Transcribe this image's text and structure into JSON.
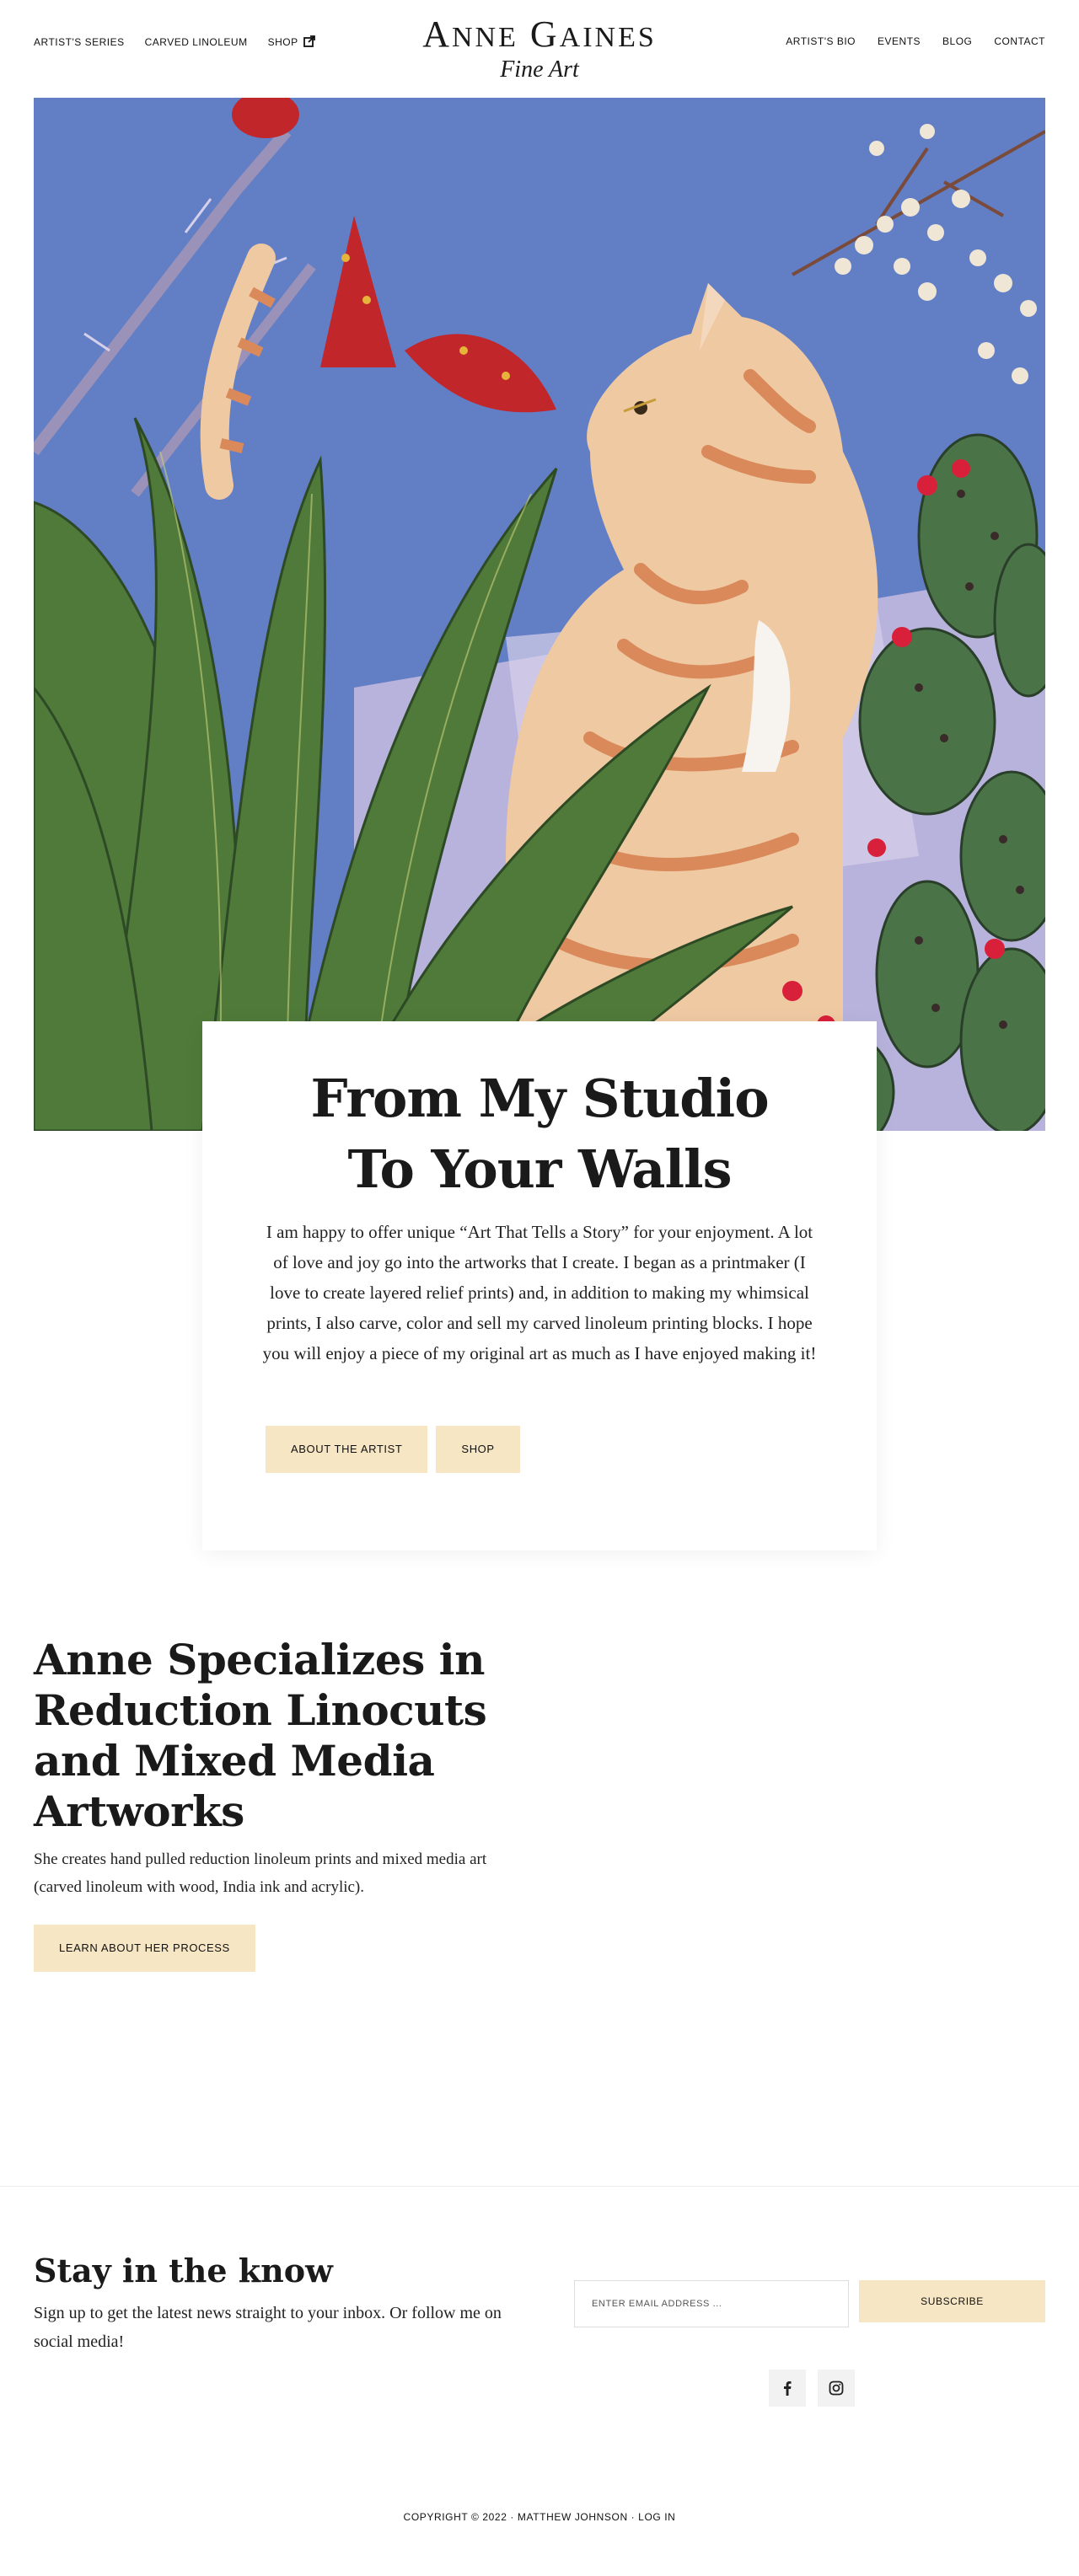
{
  "nav": {
    "left": [
      {
        "label": "Artist's Series"
      },
      {
        "label": "Carved Linoleum"
      },
      {
        "label": "Shop"
      }
    ],
    "right": [
      {
        "label": "Artist's Bio"
      },
      {
        "label": "Events"
      },
      {
        "label": "Blog"
      },
      {
        "label": "Contact"
      }
    ]
  },
  "logo": {
    "name_first_letter": "A",
    "name_first_rest": "NNE",
    "name_last_letter": "G",
    "name_last_rest": "AINES",
    "subtitle": "Fine Art"
  },
  "hero": {
    "colors": {
      "sky": "#5f7cc4",
      "cat": "#efc9a2",
      "stripes": "#d9895a",
      "agave": "#4f7a3a",
      "cactus": "#4a7448",
      "blossom": "#c0262a"
    }
  },
  "card": {
    "title_line1": "From My Studio",
    "title_line2": "To Your Walls",
    "text": "I am happy to offer unique  “Art That Tells a Story”  for your enjoyment. A lot of love and joy go into the artworks that I create. I began as a printmaker (I love to create layered relief prints) and, in addition to making my whimsical prints, I also carve, color and sell my carved linoleum printing blocks. I hope you will enjoy a piece of my original art as much as I have enjoyed making it!",
    "buttons": {
      "about": "About the Artist",
      "shop": "Shop"
    }
  },
  "specialize": {
    "title": "Anne Specializes in Reduction Linocuts and Mixed Media Artworks",
    "text": "She creates hand pulled reduction linoleum prints and mixed media art (carved linoleum with wood, India ink and acrylic).",
    "button": "Learn About Her Process"
  },
  "newsletter": {
    "title": "Stay in the know",
    "text": "Sign up to get the latest news straight to your inbox. Or follow me on social media!",
    "email_placeholder": "ENTER EMAIL ADDRESS ...",
    "subscribe": "Subscribe",
    "social": [
      "facebook-icon",
      "instagram-icon"
    ]
  },
  "footer": {
    "copyright": "Copyright © 2022 · Matthew Johnson · ",
    "login": "Log in"
  },
  "accent_color": "#f7e6c3"
}
